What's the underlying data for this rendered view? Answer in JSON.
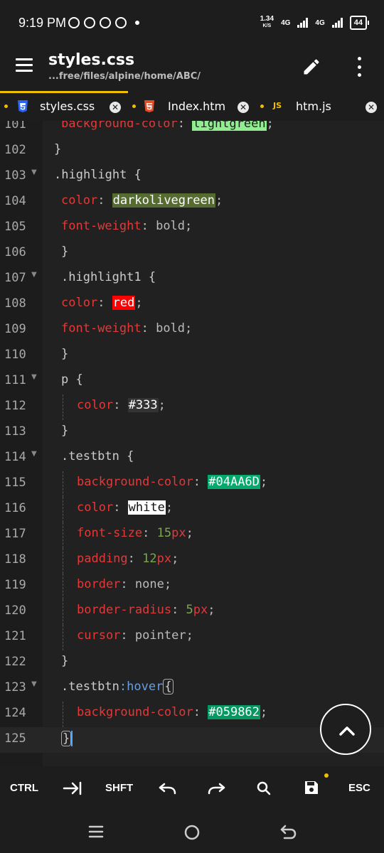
{
  "status_bar": {
    "time": "9:19 PM",
    "net_speed_value": "1.34",
    "net_speed_unit": "K/S",
    "net1": "4G",
    "net2": "4G",
    "battery": "44"
  },
  "app_bar": {
    "title": "styles.css",
    "path": "...free/files/alpine/home/ABC/"
  },
  "tabs": [
    {
      "label": "styles.css",
      "icon": "css-icon",
      "active": true
    },
    {
      "label": "Index.htm",
      "icon": "html-icon",
      "active": false
    },
    {
      "label": "htm.js",
      "icon": "js-icon",
      "active": false
    }
  ],
  "js_icon_text": "JS",
  "colors": {
    "accent": "#f0c000",
    "property": "#e03a3a",
    "number": "#7aa84a",
    "pseudo": "#6a9edb",
    "lightgreen": "#90ee90",
    "darkolivegreen": "#556b2f",
    "red": "#ff0000",
    "c333": "#333333",
    "c04AA6D": "#04AA6D",
    "white": "#ffffff",
    "c059862": "#059862"
  },
  "editor": {
    "lines": [
      {
        "n": "101",
        "prop": "background-color",
        "value": "lightgreen"
      },
      {
        "n": "102",
        "text": "}"
      },
      {
        "n": "103",
        "text": ".highlight {"
      },
      {
        "n": "104",
        "prop": "color",
        "value": "darkolivegreen"
      },
      {
        "n": "105",
        "prop": "font-weight",
        "value": "bold"
      },
      {
        "n": "106",
        "text": "}"
      },
      {
        "n": "107",
        "text": ".highlight1 {"
      },
      {
        "n": "108",
        "prop": "color",
        "value": "red"
      },
      {
        "n": "109",
        "prop": "font-weight",
        "value": "bold"
      },
      {
        "n": "110",
        "text": "}"
      },
      {
        "n": "111",
        "text": "p {"
      },
      {
        "n": "112",
        "prop": "color",
        "value": "#333"
      },
      {
        "n": "113",
        "text": "}"
      },
      {
        "n": "114",
        "text": ".testbtn {"
      },
      {
        "n": "115",
        "prop": "background-color",
        "value": "#04AA6D"
      },
      {
        "n": "116",
        "prop": "color",
        "value": "white"
      },
      {
        "n": "117",
        "prop": "font-size",
        "value_num": "15",
        "value_unit": "px"
      },
      {
        "n": "118",
        "prop": "padding",
        "value_num": "12",
        "value_unit": "px"
      },
      {
        "n": "119",
        "prop": "border",
        "value": "none"
      },
      {
        "n": "120",
        "prop": "border-radius",
        "value_num": "5",
        "value_unit": "px"
      },
      {
        "n": "121",
        "prop": "cursor",
        "value": "pointer"
      },
      {
        "n": "122",
        "text": "}"
      },
      {
        "n": "123",
        "selector": ".testbtn",
        "pseudo": ":hover",
        "brace": "{"
      },
      {
        "n": "124",
        "prop": "background-color",
        "value": "#059862"
      },
      {
        "n": "125",
        "text": "}"
      }
    ]
  },
  "keys": {
    "ctrl": "CTRL",
    "shift": "SHFT",
    "esc": "ESC"
  }
}
